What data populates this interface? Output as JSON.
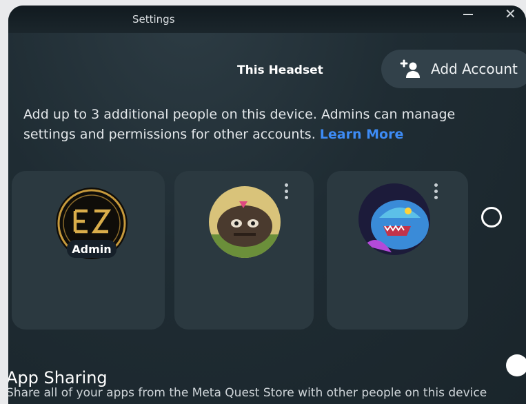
{
  "window": {
    "title": "Settings"
  },
  "header": {
    "title": "This Headset",
    "add_account_label": "Add Account"
  },
  "description": {
    "text": "Add up to 3 additional people on this device. Admins can manage settings and permissions for other accounts.",
    "link_label": "Learn More"
  },
  "accounts": [
    {
      "avatar_icon": "ez-monogram-avatar",
      "badge": "Admin"
    },
    {
      "avatar_icon": "furry-creature-avatar",
      "badge": ""
    },
    {
      "avatar_icon": "blue-dragon-avatar",
      "badge": ""
    }
  ],
  "app_sharing": {
    "title": "App Sharing",
    "subtitle": "Share all of your apps from the Meta Quest Store with other people on this device"
  },
  "colors": {
    "background": "#1f2c33",
    "card": "#2b3940",
    "link": "#3d8bf5",
    "button": "#32414a"
  }
}
